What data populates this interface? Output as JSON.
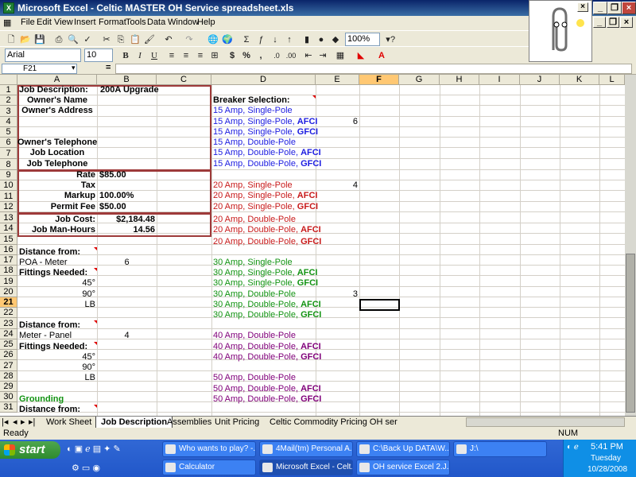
{
  "window": {
    "title": "Microsoft Excel - Celtic MASTER OH Service spreadsheet.xls"
  },
  "menu": [
    "File",
    "Edit",
    "View",
    "Insert",
    "Format",
    "Tools",
    "Data",
    "Window",
    "Help"
  ],
  "toolbar": {
    "zoom": "100%",
    "font": "Arial",
    "font_size": "10"
  },
  "formula_bar": {
    "name_box": "F21",
    "equals": "="
  },
  "columns": [
    "A",
    "B",
    "C",
    "D",
    "E",
    "F",
    "G",
    "H",
    "I",
    "J",
    "K",
    "L"
  ],
  "rows": [
    "1",
    "2",
    "3",
    "4",
    "5",
    "6",
    "7",
    "8",
    "9",
    "10",
    "11",
    "12",
    "13",
    "14",
    "15",
    "16",
    "17",
    "18",
    "19",
    "20",
    "21",
    "22",
    "23",
    "24",
    "25",
    "26",
    "27",
    "28",
    "29",
    "30",
    "31"
  ],
  "cells": {
    "A1": "Job Description:",
    "B1": "200A Upgrade",
    "A2": "Owner's Name",
    "D2": "Breaker Selection:",
    "A3": "Owner's Address",
    "D3": "15 Amp, Single-Pole",
    "D4": "15 Amp, Single-Pole, ",
    "D4b": "AFCI",
    "E4": "6",
    "D5": "15 Amp, Single-Pole, ",
    "D5b": "GFCI",
    "A6": "Owner's Telephone",
    "D6": "15 Amp, Double-Pole",
    "A7": "Job Location",
    "D7": "15 Amp, Double-Pole, ",
    "D7b": "AFCI",
    "A8": "Job Telephone",
    "D8": "15 Amp, Double-Pole, ",
    "D8b": "GFCI",
    "A9": "Rate",
    "B9": "$85.00",
    "A10": "Tax",
    "D10": "20 Amp, Single-Pole",
    "E10": "4",
    "A11": "Markup",
    "B11": "100.00%",
    "D11": "20 Amp, Single-Pole, ",
    "D11b": "AFCI",
    "A12": "Permit Fee",
    "B12": "$50.00",
    "D12": "20 Amp, Single-Pole, ",
    "D12b": "GFCI",
    "A13": "Job Cost:",
    "B13": "$2,184.48",
    "D13": "20 Amp, Double-Pole",
    "A14": "Job Man-Hours",
    "B14": "14.56",
    "D14": "20 Amp, Double-Pole, ",
    "D14b": "AFCI",
    "D15": "20 Amp, Double-Pole, ",
    "D15b": "GFCI",
    "A16": "Distance from:",
    "A17": "POA - Meter",
    "B17": "6",
    "D17": "30 Amp, Single-Pole",
    "A18": "Fittings Needed:",
    "D18": "30 Amp, Single-Pole, ",
    "D18b": "AFCI",
    "A19": "45°",
    "D19": "30 Amp, Single-Pole, ",
    "D19b": "GFCI",
    "A20": "90°",
    "D20": "30 Amp, Double-Pole",
    "E20": "3",
    "A21": "LB",
    "D21": "30 Amp, Double-Pole, ",
    "D21b": "AFCI",
    "D22": "30 Amp, Double-Pole, ",
    "D22b": "GFCI",
    "A23": "Distance from:",
    "A24": "Meter - Panel",
    "B24": "4",
    "D24": "40 Amp, Double-Pole",
    "A25": "Fittings Needed:",
    "D25": "40 Amp, Double-Pole, ",
    "D25b": "AFCI",
    "A26": "45°",
    "D26": "40 Amp, Double-Pole, ",
    "D26b": "GFCI",
    "A27": "90°",
    "A28": "LB",
    "D28": "50 Amp, Double-Pole",
    "A29": "",
    "D29": "50 Amp, Double-Pole, ",
    "D29b": "AFCI",
    "A30": "Grounding",
    "D30": "50 Amp, Double-Pole, ",
    "D30b": "GFCI",
    "A31": "Distance from:"
  },
  "sheet_tabs": [
    "Work Sheet",
    "Job Description",
    "Assemblies",
    "Unit Pricing",
    "Celtic Commodity Pricing OH ser"
  ],
  "active_tab": "Job Description",
  "status": {
    "left": "Ready",
    "num": "NUM"
  },
  "taskbar": {
    "start": "start",
    "tasks_row1": [
      "Who wants to play? -...",
      "4Mail(tm) Personal A...",
      "C:\\Back Up DATA\\W...",
      "J:\\"
    ],
    "tasks_row2": [
      "Calculator",
      "Microsoft Excel - Celt...",
      "OH service Excel 2.J..."
    ],
    "time": "5:41 PM",
    "day": "Tuesday",
    "date": "10/28/2008"
  },
  "colors": {
    "title_bar": "#0a246a",
    "excel_green": "#1e7e34",
    "box_border": "#9e3a3a",
    "breaker_15": "#1c1ce0",
    "breaker_20": "#c81a1a",
    "breaker_30": "#129312",
    "breaker_40_50": "#80007a"
  }
}
